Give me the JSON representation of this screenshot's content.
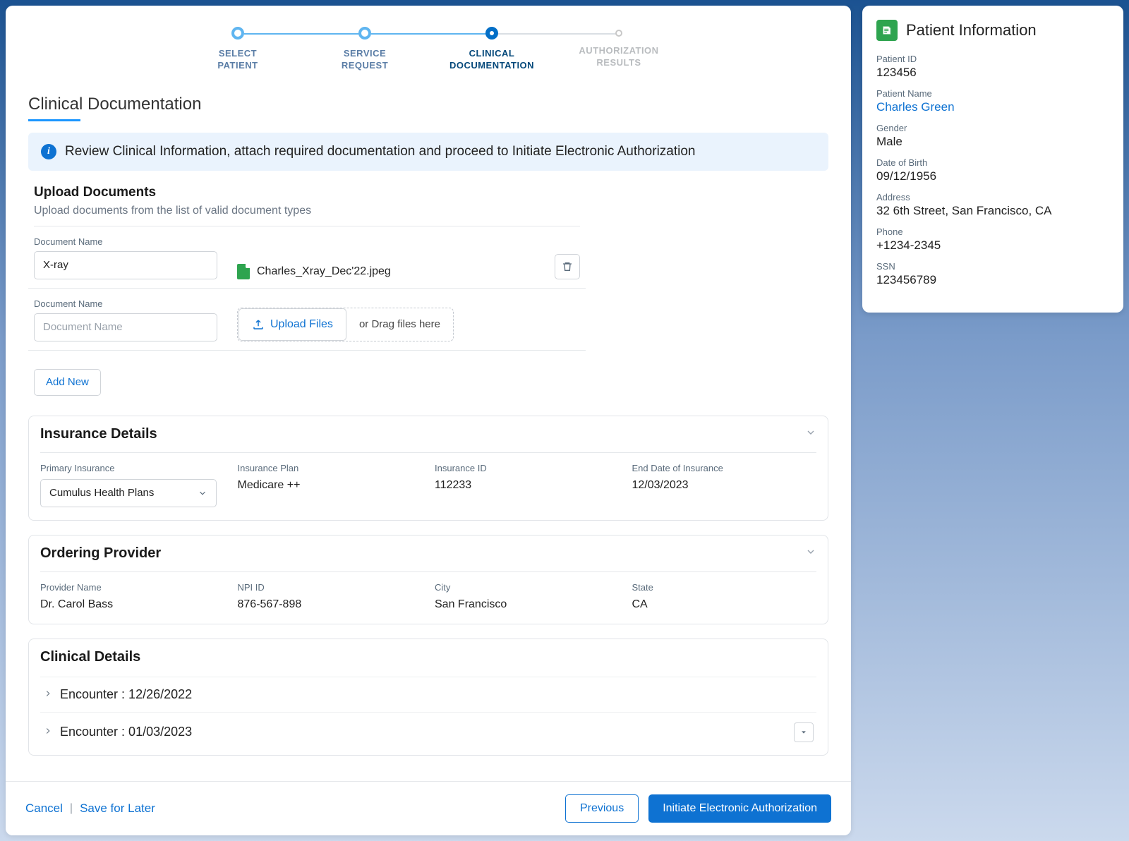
{
  "stepper": {
    "steps": [
      {
        "label": "SELECT\nPATIENT"
      },
      {
        "label": "SERVICE\nREQUEST"
      },
      {
        "label": "CLINICAL\nDOCUMENTATION"
      },
      {
        "label": "AUTHORIZATION\nRESULTS"
      }
    ]
  },
  "page": {
    "title": "Clinical Documentation",
    "banner": "Review Clinical Information, attach required documentation and proceed to Initiate Electronic Authorization"
  },
  "upload": {
    "heading": "Upload Documents",
    "sub": "Upload documents from the list of valid document types",
    "doc_label": "Document Name",
    "row1_value": "X-ray",
    "file_name": "Charles_Xray_Dec'22.jpeg",
    "row2_placeholder": "Document Name",
    "upload_btn": "Upload Files",
    "drag_hint": "or Drag files here",
    "add_new": "Add New"
  },
  "insurance": {
    "title": "Insurance Details",
    "primary_label": "Primary Insurance",
    "primary_value": "Cumulus Health Plans",
    "plan_label": "Insurance Plan",
    "plan_value": "Medicare ++",
    "id_label": "Insurance ID",
    "id_value": "112233",
    "end_label": "End Date of Insurance",
    "end_value": "12/03/2023"
  },
  "provider": {
    "title": "Ordering Provider",
    "name_label": "Provider Name",
    "name_value": "Dr. Carol Bass",
    "npi_label": "NPI ID",
    "npi_value": "876-567-898",
    "city_label": "City",
    "city_value": "San Francisco",
    "state_label": "State",
    "state_value": "CA"
  },
  "clinical": {
    "title": "Clinical Details",
    "encounters": [
      "Encounter : 12/26/2022",
      "Encounter : 01/03/2023"
    ]
  },
  "footer": {
    "cancel": "Cancel",
    "save": "Save for Later",
    "previous": "Previous",
    "submit": "Initiate Electronic Authorization"
  },
  "patient": {
    "panel_title": "Patient Information",
    "id_label": "Patient ID",
    "id_value": "123456",
    "name_label": "Patient Name",
    "name_value": "Charles Green",
    "gender_label": "Gender",
    "gender_value": "Male",
    "dob_label": "Date of Birth",
    "dob_value": "09/12/1956",
    "addr_label": "Address",
    "addr_value": "32 6th Street, San Francisco, CA",
    "phone_label": "Phone",
    "phone_value": "+1234-2345",
    "ssn_label": "SSN",
    "ssn_value": "123456789"
  }
}
